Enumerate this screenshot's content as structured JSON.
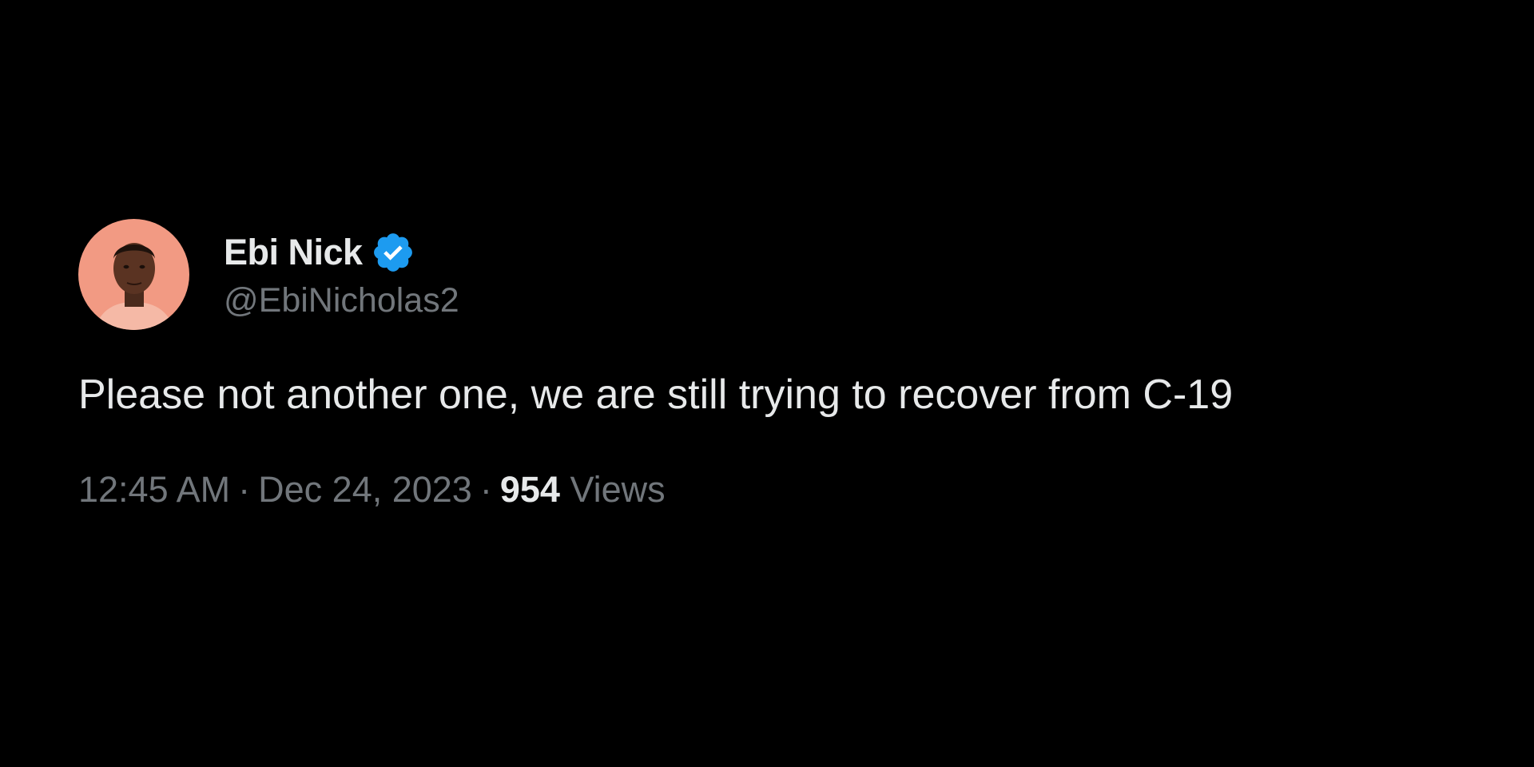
{
  "tweet": {
    "author": {
      "display_name": "Ebi Nick",
      "handle": "@EbiNicholas2",
      "verified": true
    },
    "text": "Please not another one, we are still trying to recover from C-19",
    "meta": {
      "time": "12:45 AM",
      "separator": "·",
      "date": "Dec 24, 2023",
      "views_count": "954",
      "views_label": "Views"
    }
  },
  "icons": {
    "avatar": "profile-photo",
    "verified": "verified-badge-icon"
  },
  "colors": {
    "background": "#000000",
    "primary_text": "#e7e9ea",
    "secondary_text": "#71767b",
    "verified_blue": "#1d9bf0",
    "avatar_bg": "#f29a83"
  }
}
